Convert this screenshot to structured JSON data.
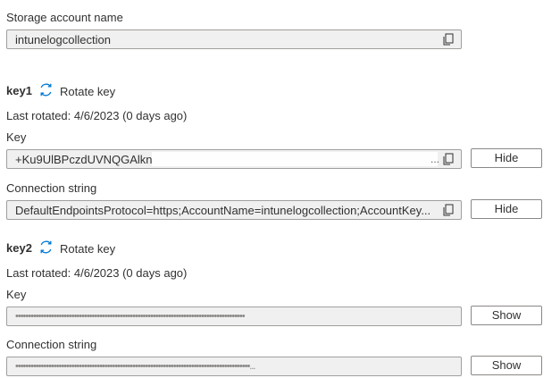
{
  "storage": {
    "label": "Storage account name",
    "value": "intunelogcollection"
  },
  "key1": {
    "title": "key1",
    "rotate_label": "Rotate key",
    "last_rotated": "Last rotated: 4/6/2023 (0 days ago)",
    "key_label": "Key",
    "key_value": "+Ku9UlBPczdUVNQGAlkn",
    "key_button": "Hide",
    "conn_label": "Connection string",
    "conn_value": "DefaultEndpointsProtocol=https;AccountName=intunelogcollection;AccountKey...",
    "conn_button": "Hide"
  },
  "key2": {
    "title": "key2",
    "rotate_label": "Rotate key",
    "last_rotated": "Last rotated: 4/6/2023 (0 days ago)",
    "key_label": "Key",
    "key_value": "••••••••••••••••••••••••••••••••••••••••••••••••••••••••••••••••••••••••••••••••••••••••••",
    "key_button": "Show",
    "conn_label": "Connection string",
    "conn_value": "••••••••••••••••••••••••••••••••••••••••••••••••••••••••••••••••••••••••••••••••••••••••••••...",
    "conn_button": "Show"
  },
  "icons": {
    "copy": "copy-icon",
    "rotate": "rotate-icon"
  },
  "colors": {
    "accent": "#0078d4",
    "field_bg": "#f0f0f0",
    "border": "#a19f9d"
  }
}
